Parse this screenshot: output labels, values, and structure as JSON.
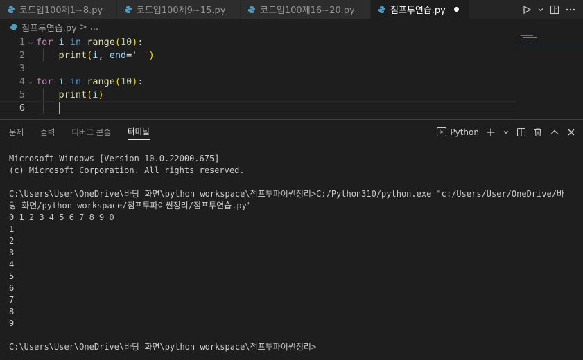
{
  "tabs": [
    {
      "label": "코드업100제1~8.py",
      "active": false
    },
    {
      "label": "코드업100제9~15.py",
      "active": false
    },
    {
      "label": "코드업100제16~20.py",
      "active": false
    },
    {
      "label": "점프투연습.py",
      "active": true,
      "dirty": true
    }
  ],
  "tab_actions": {
    "run_icon": "play-icon",
    "run_dropdown_icon": "chevron-down-icon",
    "split_icon": "split-editor-icon",
    "more_icon": "ellipsis-icon"
  },
  "breadcrumb": {
    "file": "점프투연습.py",
    "separator": ">",
    "tail": "..."
  },
  "editor": {
    "line_numbers": [
      "1",
      "2",
      "3",
      "4",
      "5",
      "6"
    ],
    "lines": [
      "for i in range(10):",
      "    print(i, end=' ')",
      "",
      "for i in range(10):",
      "    print(i)",
      ""
    ],
    "tokens": {
      "for": "for",
      "i": "i",
      "in": "in",
      "range": "range",
      "ten": "10",
      "paren_open": "(",
      "paren_close": ")",
      "colon": ":",
      "print": "print",
      "comma": ",",
      "end": "end",
      "eq": "=",
      "space_str": "' '"
    }
  },
  "panel": {
    "tabs": [
      "문제",
      "출력",
      "디버그 콘솔",
      "터미널"
    ],
    "active_tab": "터미널",
    "shell_label": "Python",
    "actions": [
      "plus-icon",
      "chevron-down-icon",
      "split-terminal-icon",
      "trash-icon",
      "chevron-up-icon",
      "close-icon"
    ]
  },
  "terminal": {
    "lines": [
      "Microsoft Windows [Version 10.0.22000.675]",
      "(c) Microsoft Corporation. All rights reserved.",
      "",
      "C:\\Users\\User\\OneDrive\\바탕 화면\\python workspace\\점프투파이썬정리>C:/Python310/python.exe \"c:/Users/User/OneDrive/바",
      "탕 화면/python workspace/점프투파이썬정리/점프투연습.py\"",
      "0 1 2 3 4 5 6 7 8 9 0",
      "1",
      "2",
      "3",
      "4",
      "5",
      "6",
      "7",
      "8",
      "9",
      "",
      "C:\\Users\\User\\OneDrive\\바탕 화면\\python workspace\\점프투파이썬정리>"
    ]
  },
  "colors": {
    "accent": "#569cd6",
    "python_icon": "#519aba",
    "background": "#1e1e1e"
  }
}
